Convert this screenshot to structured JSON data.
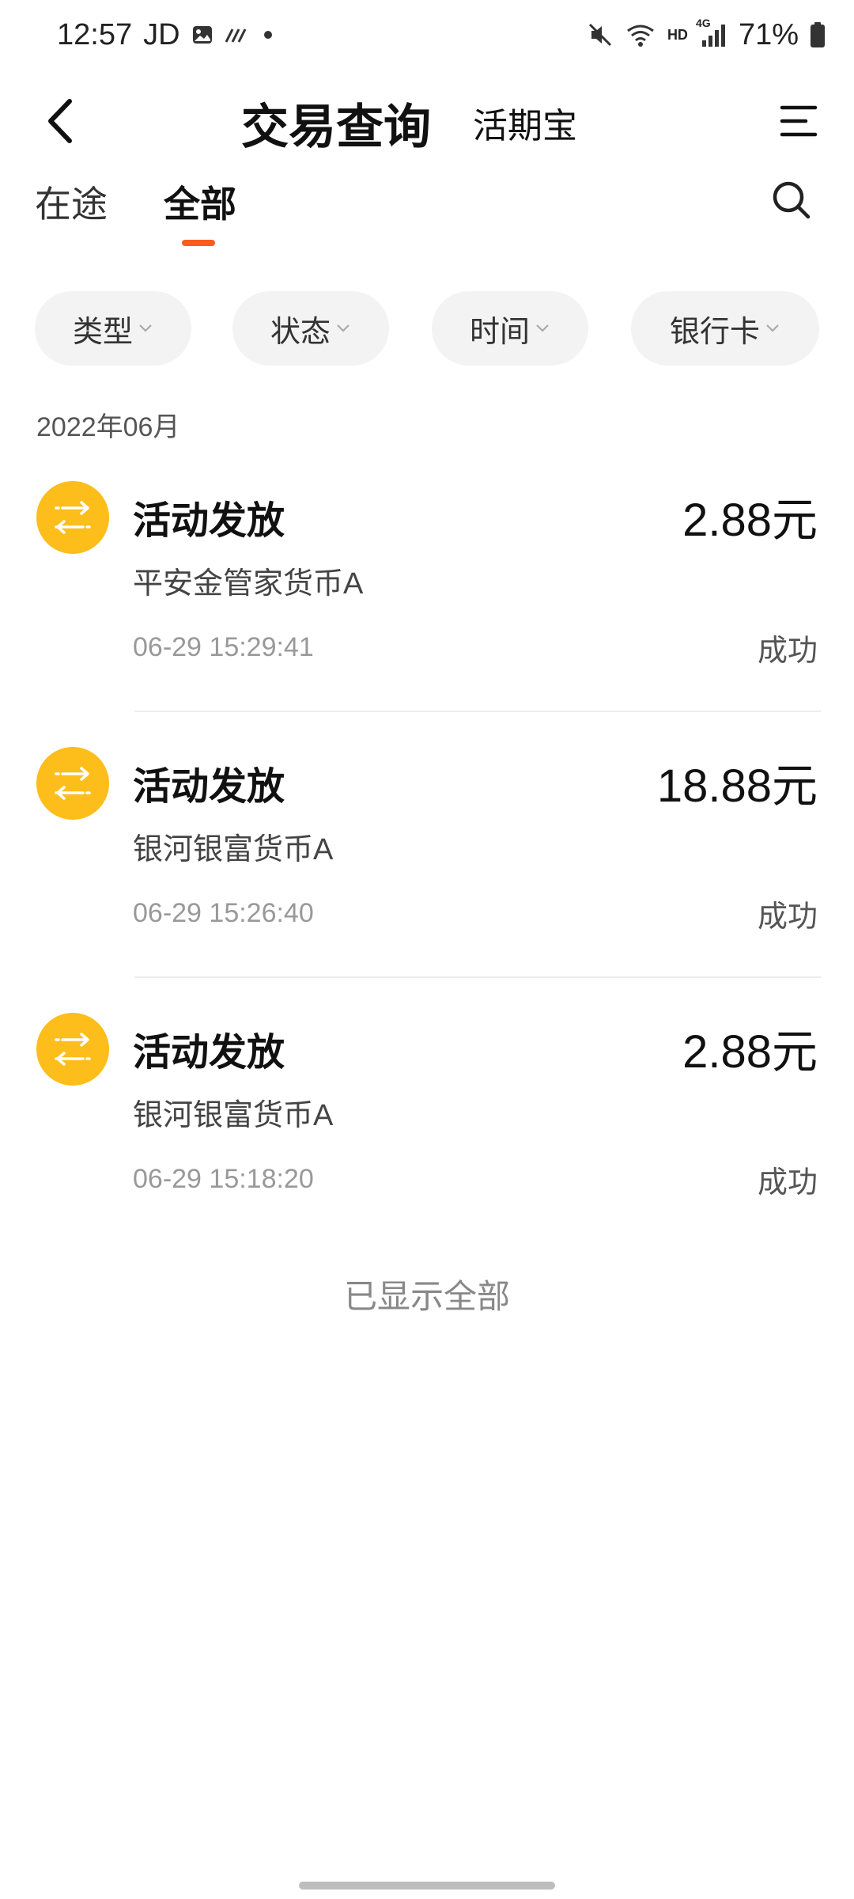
{
  "status_bar": {
    "time": "12:57",
    "carrier": "JD",
    "network_label": "HD",
    "signal_label": "4G",
    "battery": "71%"
  },
  "header": {
    "title": "交易查询",
    "subtitle": "活期宝"
  },
  "tabs": [
    {
      "label": "在途",
      "active": false
    },
    {
      "label": "全部",
      "active": true
    }
  ],
  "filters": [
    {
      "label": "类型"
    },
    {
      "label": "状态"
    },
    {
      "label": "时间"
    },
    {
      "label": "银行卡"
    }
  ],
  "month": "2022年06月",
  "records": [
    {
      "type": "活动发放",
      "fund": "平安金管家货币A",
      "amount": "2.88元",
      "time": "06-29 15:29:41",
      "status": "成功"
    },
    {
      "type": "活动发放",
      "fund": "银河银富货币A",
      "amount": "18.88元",
      "time": "06-29 15:26:40",
      "status": "成功"
    },
    {
      "type": "活动发放",
      "fund": "银河银富货币A",
      "amount": "2.88元",
      "time": "06-29 15:18:20",
      "status": "成功"
    }
  ],
  "end_note": "已显示全部",
  "colors": {
    "accent": "#ff5a1f",
    "icon_bg": "#fdbd1b",
    "chip_bg": "#f3f3f3"
  },
  "icons": {
    "back": "chevron-left-icon",
    "menu": "menu-icon",
    "search": "search-icon",
    "record": "transfer-icon"
  }
}
